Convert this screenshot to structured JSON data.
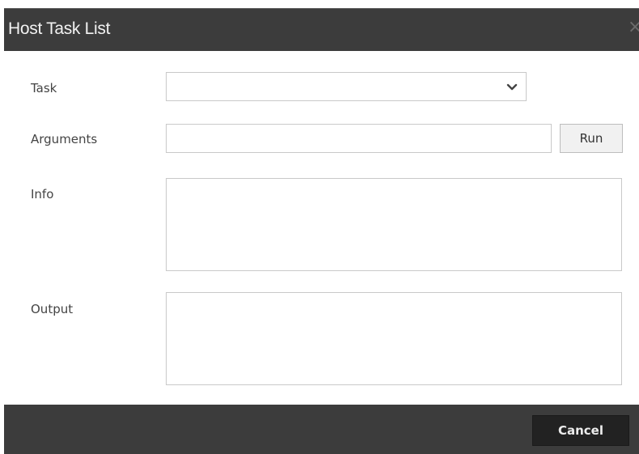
{
  "dialog": {
    "title": "Host Task List",
    "close_icon": "close-icon"
  },
  "form": {
    "task_label": "Task",
    "task_value": "",
    "arguments_label": "Arguments",
    "arguments_value": "",
    "run_label": "Run",
    "info_label": "Info",
    "info_value": "",
    "output_label": "Output",
    "output_value": ""
  },
  "footer": {
    "cancel_label": "Cancel"
  },
  "colors": {
    "titlebar": "#3c3c3c",
    "footer": "#3c3c3c",
    "cancel_button": "#222222",
    "run_button": "#f1f1f1",
    "border": "#c9c9c9"
  }
}
